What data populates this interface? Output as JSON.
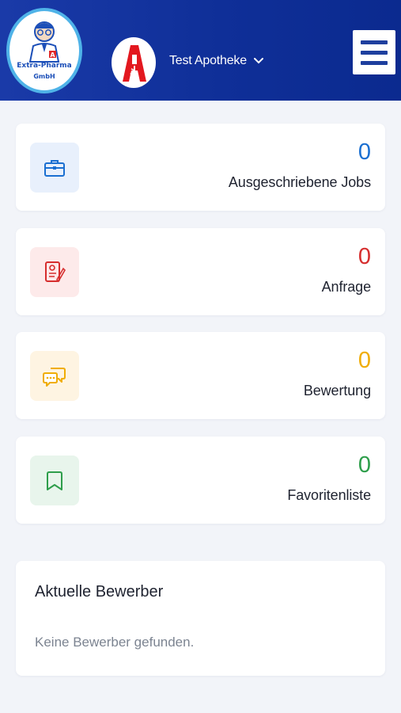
{
  "header": {
    "logo": {
      "line1": "Extra-Pharma",
      "line2": "GmbH"
    },
    "pharmacy_name": "Test Apotheke"
  },
  "stats": [
    {
      "count": "0",
      "label": "Ausgeschriebene Jobs",
      "icon": "briefcase-icon",
      "color": "#1a6fd1",
      "tint": "#e8f0fc"
    },
    {
      "count": "0",
      "label": "Anfrage",
      "icon": "document-edit-icon",
      "color": "#d62e2e",
      "tint": "#fdeaea"
    },
    {
      "count": "0",
      "label": "Bewertung",
      "icon": "chat-bubbles-icon",
      "color": "#f0ad06",
      "tint": "#fef4e2"
    },
    {
      "count": "0",
      "label": "Favoritenliste",
      "icon": "bookmark-icon",
      "color": "#2e9e4b",
      "tint": "#e8f5ec"
    }
  ],
  "applicants": {
    "title": "Aktuelle Bewerber",
    "empty_text": "Keine Bewerber gefunden."
  }
}
